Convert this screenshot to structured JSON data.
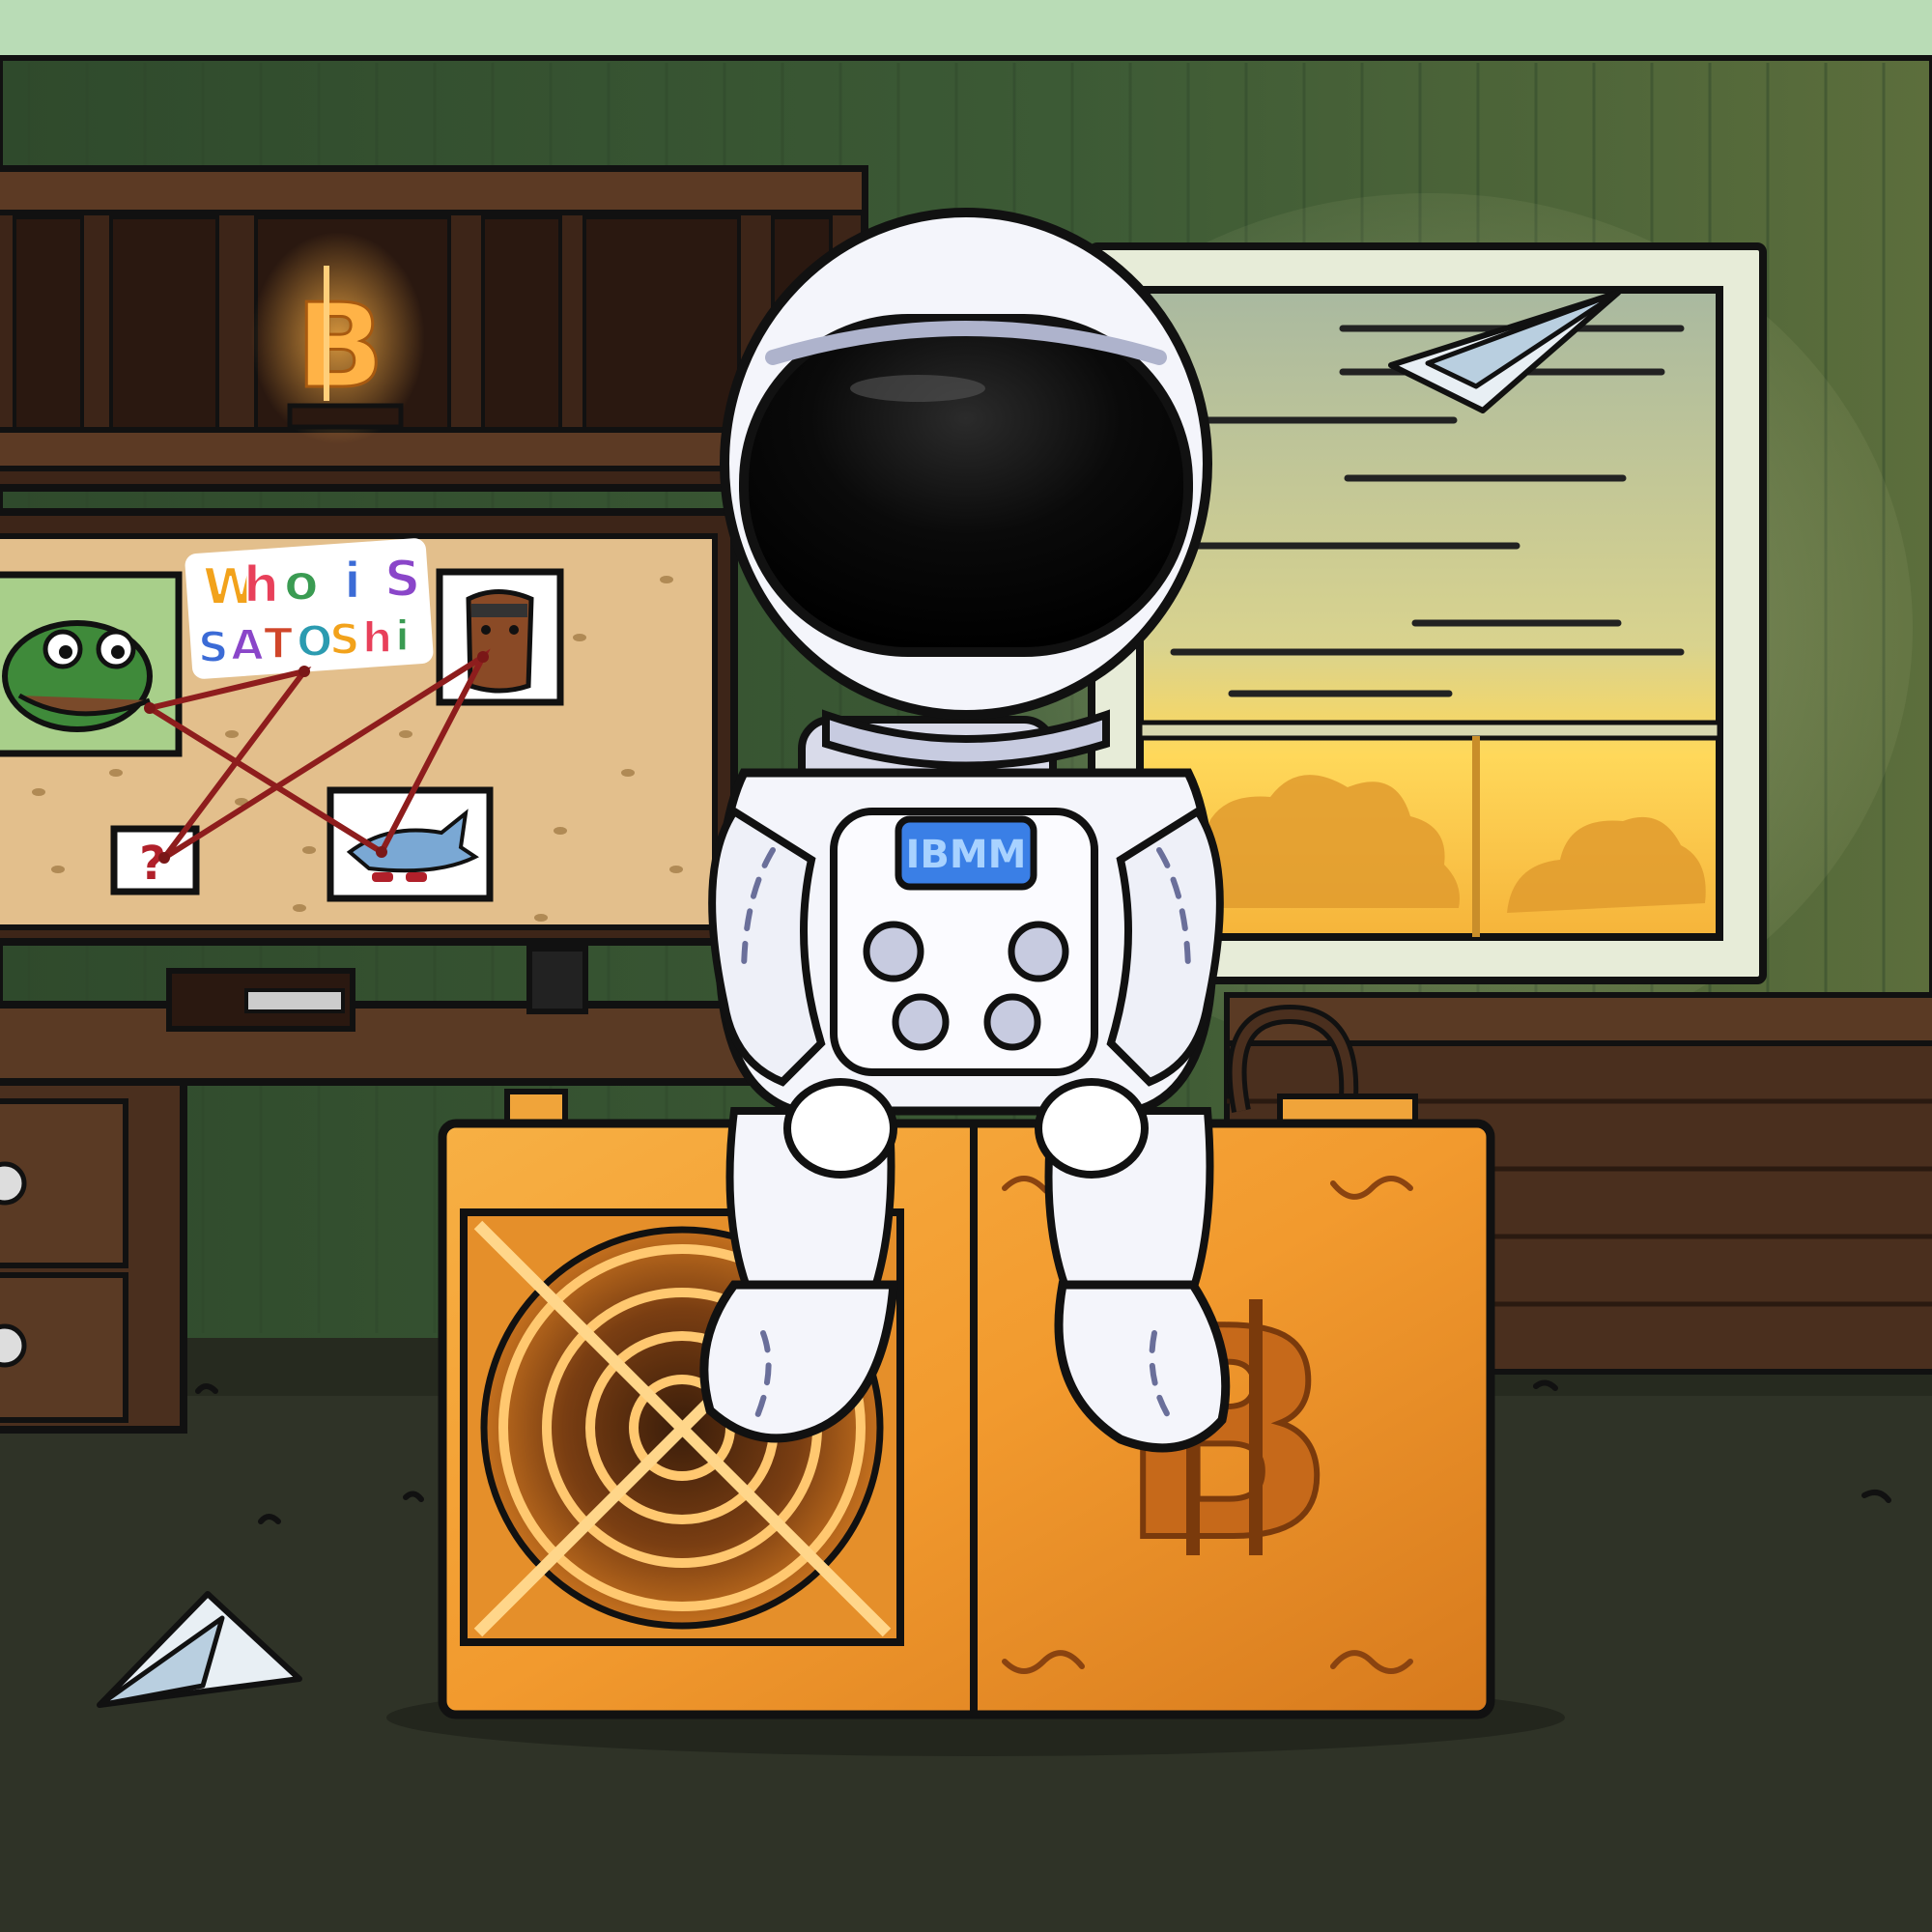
{
  "scene": {
    "board_note": {
      "line1": [
        "W",
        "h",
        "o",
        "i",
        "S"
      ],
      "line2": [
        "S",
        "A",
        "T",
        "O",
        "S",
        "h",
        "i"
      ]
    },
    "board_question": "?",
    "suit_badge": "IBMM",
    "shelf_sign": "B",
    "colors": {
      "wall": "#3f5c38",
      "ceiling": "#b9dcb6",
      "floor": "#2f3327",
      "wood_dark": "#3d2518",
      "cork": "#e3bf8c",
      "miner_gold": "#f0a43a",
      "thread": "#8e1d1d",
      "visor": "#050505",
      "badge": "#3a7fe6"
    }
  }
}
